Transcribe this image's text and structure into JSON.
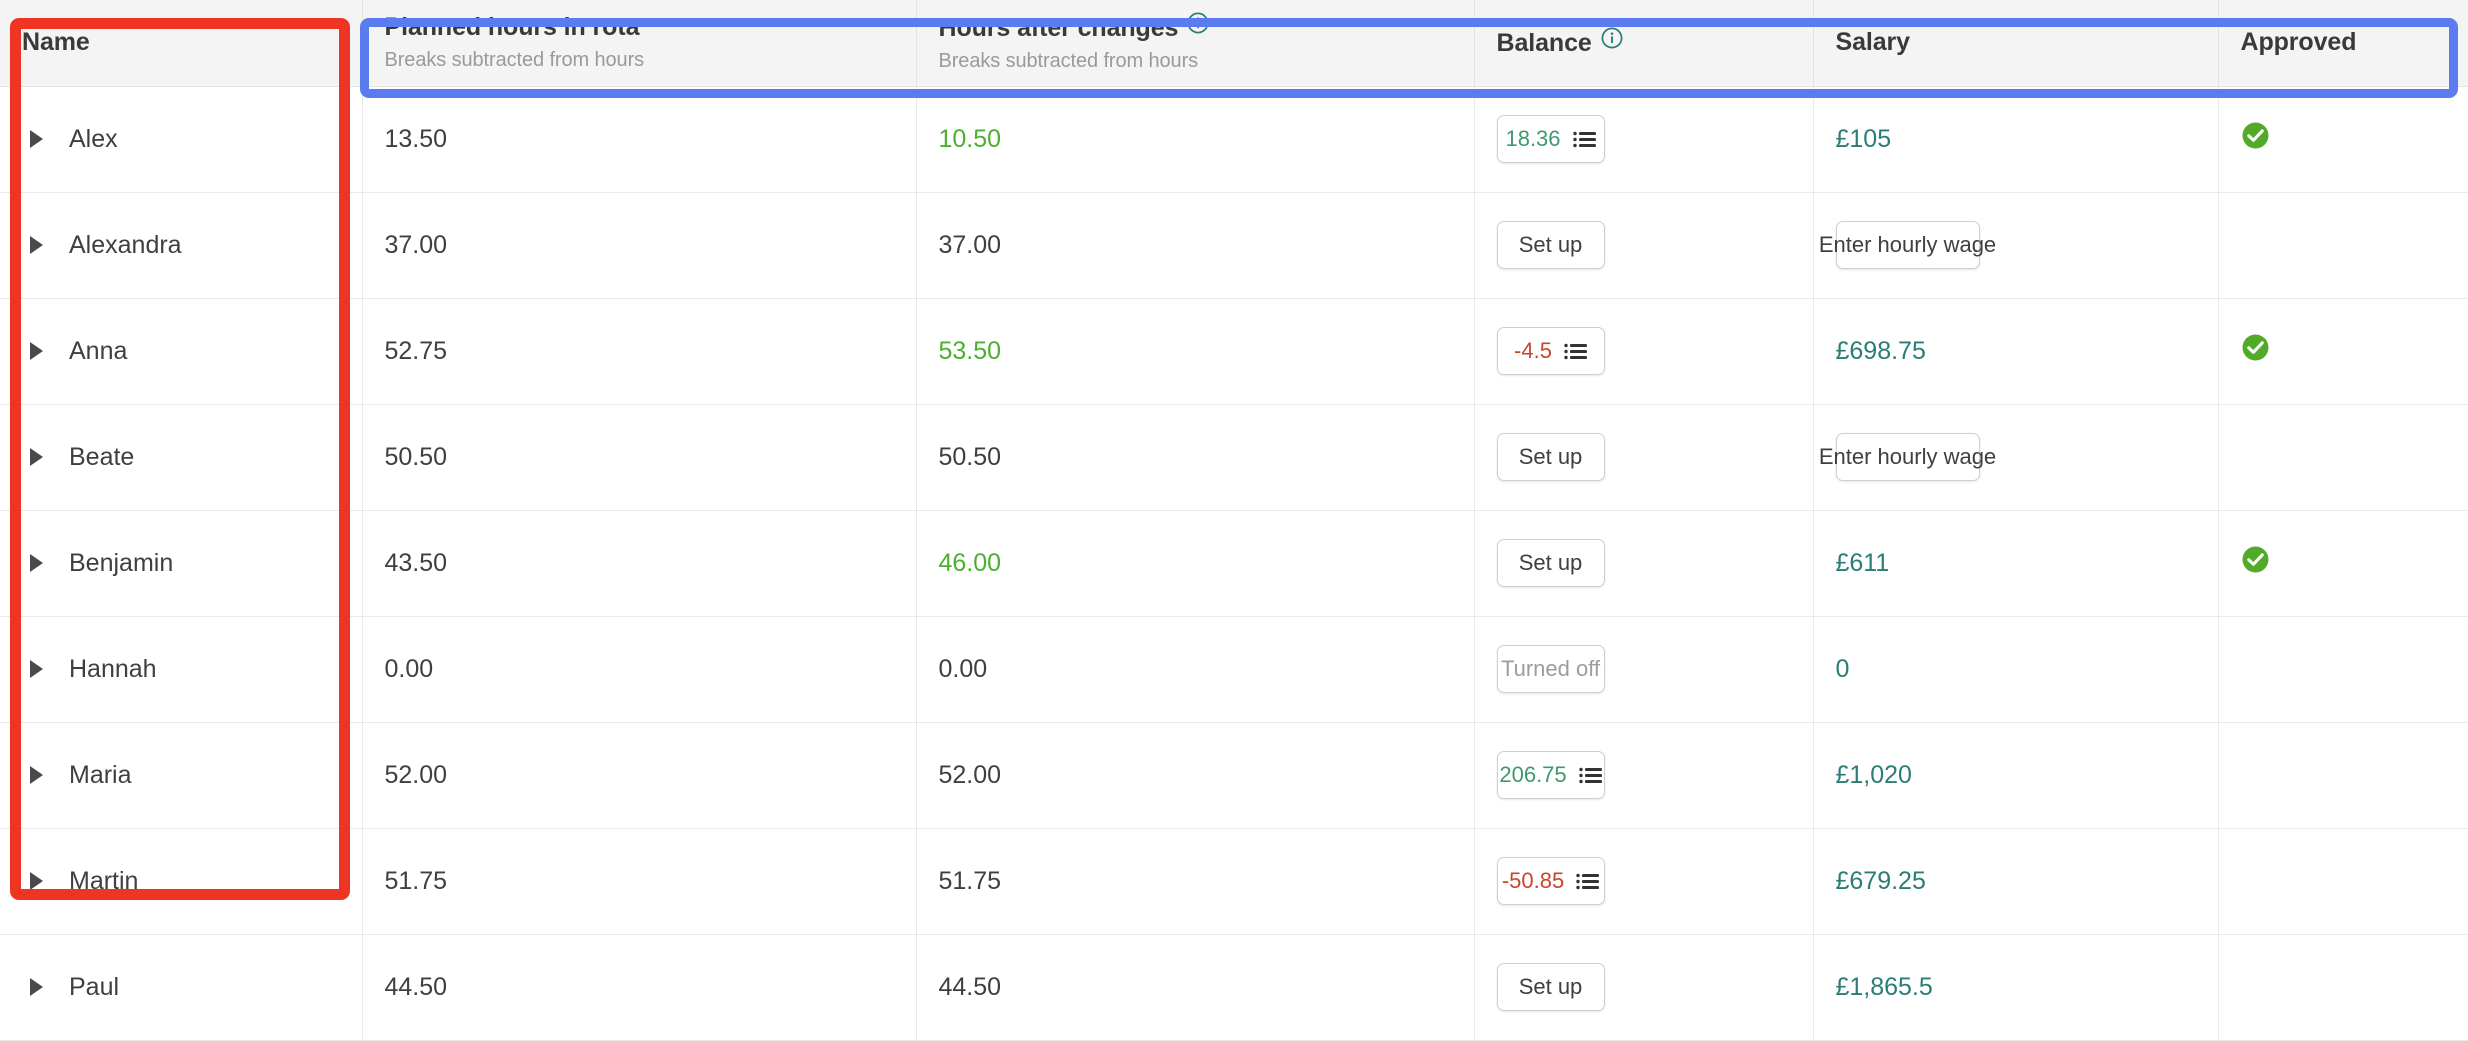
{
  "table": {
    "columns": [
      {
        "key": "name",
        "title": "Name",
        "subtitle": "",
        "info": false
      },
      {
        "key": "planned",
        "title": "Planned hours in rota",
        "subtitle": "Breaks subtracted from hours",
        "info": false
      },
      {
        "key": "after",
        "title": "Hours after changes",
        "subtitle": "Breaks subtracted from hours",
        "info": true
      },
      {
        "key": "balance",
        "title": "Balance",
        "subtitle": "",
        "info": true
      },
      {
        "key": "salary",
        "title": "Salary",
        "subtitle": "",
        "info": false
      },
      {
        "key": "approved",
        "title": "Approved",
        "subtitle": "",
        "info": false
      }
    ],
    "rows": [
      {
        "name": "Alex",
        "planned": "13.50",
        "after": "10.50",
        "after_changed": true,
        "balance": {
          "kind": "value",
          "label": "18.36",
          "sign": "pos"
        },
        "salary": {
          "kind": "money",
          "label": "£105"
        },
        "approved": true
      },
      {
        "name": "Alexandra",
        "planned": "37.00",
        "after": "37.00",
        "after_changed": false,
        "balance": {
          "kind": "setup",
          "label": "Set up"
        },
        "salary": {
          "kind": "button",
          "label": "Enter hourly wage"
        },
        "approved": false
      },
      {
        "name": "Anna",
        "planned": "52.75",
        "after": "53.50",
        "after_changed": true,
        "balance": {
          "kind": "value",
          "label": "-4.5",
          "sign": "neg"
        },
        "salary": {
          "kind": "money",
          "label": "£698.75"
        },
        "approved": true
      },
      {
        "name": "Beate",
        "planned": "50.50",
        "after": "50.50",
        "after_changed": false,
        "balance": {
          "kind": "setup",
          "label": "Set up"
        },
        "salary": {
          "kind": "button",
          "label": "Enter hourly wage"
        },
        "approved": false
      },
      {
        "name": "Benjamin",
        "planned": "43.50",
        "after": "46.00",
        "after_changed": true,
        "balance": {
          "kind": "setup",
          "label": "Set up"
        },
        "salary": {
          "kind": "money",
          "label": "£611"
        },
        "approved": true
      },
      {
        "name": "Hannah",
        "planned": "0.00",
        "after": "0.00",
        "after_changed": false,
        "balance": {
          "kind": "off",
          "label": "Turned off"
        },
        "salary": {
          "kind": "money",
          "label": "0"
        },
        "approved": false
      },
      {
        "name": "Maria",
        "planned": "52.00",
        "after": "52.00",
        "after_changed": false,
        "balance": {
          "kind": "value",
          "label": "206.75",
          "sign": "pos"
        },
        "salary": {
          "kind": "money",
          "label": "£1,020"
        },
        "approved": false
      },
      {
        "name": "Martin",
        "planned": "51.75",
        "after": "51.75",
        "after_changed": false,
        "balance": {
          "kind": "value",
          "label": "-50.85",
          "sign": "neg"
        },
        "salary": {
          "kind": "money",
          "label": "£679.25"
        },
        "approved": false
      },
      {
        "name": "Paul",
        "planned": "44.50",
        "after": "44.50",
        "after_changed": false,
        "balance": {
          "kind": "setup",
          "label": "Set up"
        },
        "salary": {
          "kind": "money",
          "label": "£1,865.5"
        },
        "approved": false
      }
    ]
  },
  "icons": {
    "info": "info-circle-icon",
    "list": "list-lines-icon",
    "check": "check-circle-icon",
    "caret": "caret-right-icon"
  },
  "annotations": [
    {
      "name": "name-column-highlight",
      "color": "#ee3524"
    },
    {
      "name": "header-row-highlight",
      "color": "#5b7cf0"
    }
  ],
  "colors": {
    "accent_red": "#ee3524",
    "accent_blue": "#5b7cf0",
    "changed_green": "#4caf2f",
    "balance_positive": "#3e9a6e",
    "balance_negative": "#c9462a",
    "salary_teal": "#2a7d76",
    "approved_green": "#52ab28",
    "info_teal": "#2a7d76"
  }
}
